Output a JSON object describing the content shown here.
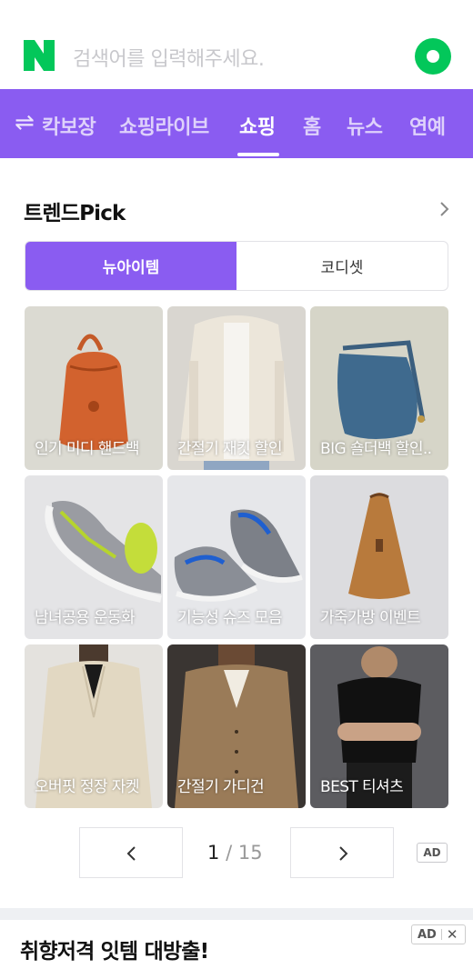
{
  "search": {
    "placeholder": "검색어를 입력해주세요.",
    "logo_icon": "naver-n-logo",
    "action_icon": "green-dot-icon"
  },
  "tabs": {
    "switch_icon": "⇌",
    "items": [
      {
        "label": "칵보장"
      },
      {
        "label": "쇼핑라이브"
      },
      {
        "label": "쇼핑",
        "active": true
      },
      {
        "label": "홈"
      },
      {
        "label": "뉴스"
      },
      {
        "label": "연예"
      }
    ]
  },
  "trend": {
    "title": "트렌드Pick",
    "segments": [
      "뉴아이템",
      "코디셋"
    ],
    "active_segment": 0,
    "cards": [
      {
        "label": "인기 미디 핸드백",
        "item": "orange-bucket-bag"
      },
      {
        "label": "간절기 재킷 할인",
        "item": "beige-jacket"
      },
      {
        "label": "BIG 숄더백 할인..",
        "item": "blue-shoulder-bag"
      },
      {
        "label": "남녀공용 운동화",
        "item": "gray-sneaker"
      },
      {
        "label": "기능성 슈즈 모음",
        "item": "blue-gray-running-shoes"
      },
      {
        "label": "가죽가방 이벤트",
        "item": "brown-leather-bag"
      },
      {
        "label": "오버핏 정장 자켓",
        "item": "cream-suit"
      },
      {
        "label": "간절기 가디건",
        "item": "brown-cardigan"
      },
      {
        "label": "BEST 티셔츠",
        "item": "black-tshirt"
      }
    ]
  },
  "pager": {
    "current": "1",
    "separator": "/",
    "total": "15",
    "ad_badge": "AD"
  },
  "ad_section": {
    "title": "취향저격 잇템 대방출!",
    "badge": "AD",
    "close": "✕"
  },
  "colors": {
    "brand_green": "#03c75a",
    "accent_purple": "#8a5cf1"
  }
}
